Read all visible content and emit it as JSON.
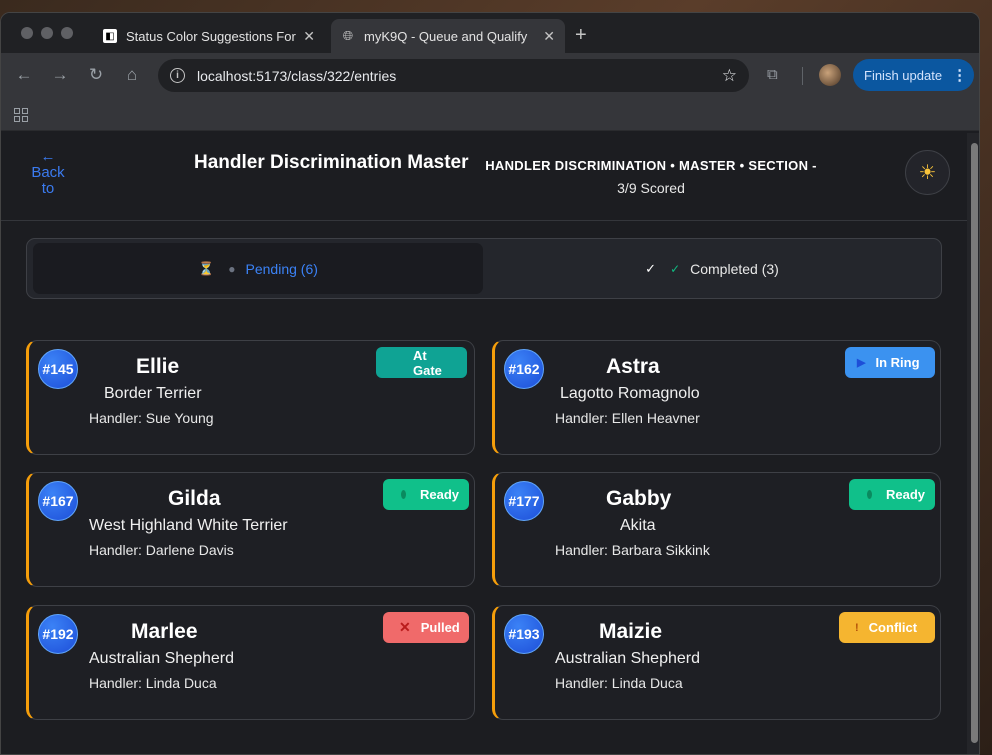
{
  "browser": {
    "tabs": [
      {
        "title": "Status Color Suggestions For",
        "active": false
      },
      {
        "title": "myK9Q - Queue and Qualify",
        "active": true
      }
    ],
    "url": "localhost:5173/class/322/entries",
    "update_label": "Finish update"
  },
  "header": {
    "back_label": "← Back to Classes",
    "title": "Handler Discrimination Master",
    "subtitle": "HANDLER DISCRIMINATION • MASTER • SECTION -",
    "scored": "3/9 Scored"
  },
  "tabs": {
    "pending": "Pending (6)",
    "completed": "Completed (3)"
  },
  "entries": [
    {
      "number": "#145",
      "name": "Ellie",
      "breed": "Border Terrier",
      "handler": "Handler: Sue Young",
      "status": "At Gate",
      "status_color": "#0fa394"
    },
    {
      "number": "#162",
      "name": "Astra",
      "breed": "Lagotto Romagnolo",
      "handler": "Handler: Ellen Heavner",
      "status": "In Ring",
      "status_color": "#3b92f0"
    },
    {
      "number": "#167",
      "name": "Gilda",
      "breed": "West Highland White Terrier",
      "handler": "Handler: Darlene Davis",
      "status": "Ready",
      "status_color": "#10c08a"
    },
    {
      "number": "#177",
      "name": "Gabby",
      "breed": "Akita",
      "handler": "Handler: Barbara Sikkink",
      "status": "Ready",
      "status_color": "#10c08a"
    },
    {
      "number": "#192",
      "name": "Marlee",
      "breed": "Australian Shepherd",
      "handler": "Handler: Linda Duca",
      "status": "Pulled",
      "status_color": "#f06a6a"
    },
    {
      "number": "#193",
      "name": "Maizie",
      "breed": "Australian Shepherd",
      "handler": "Handler: Linda Duca",
      "status": "Conflict",
      "status_color": "#f5b530"
    }
  ]
}
